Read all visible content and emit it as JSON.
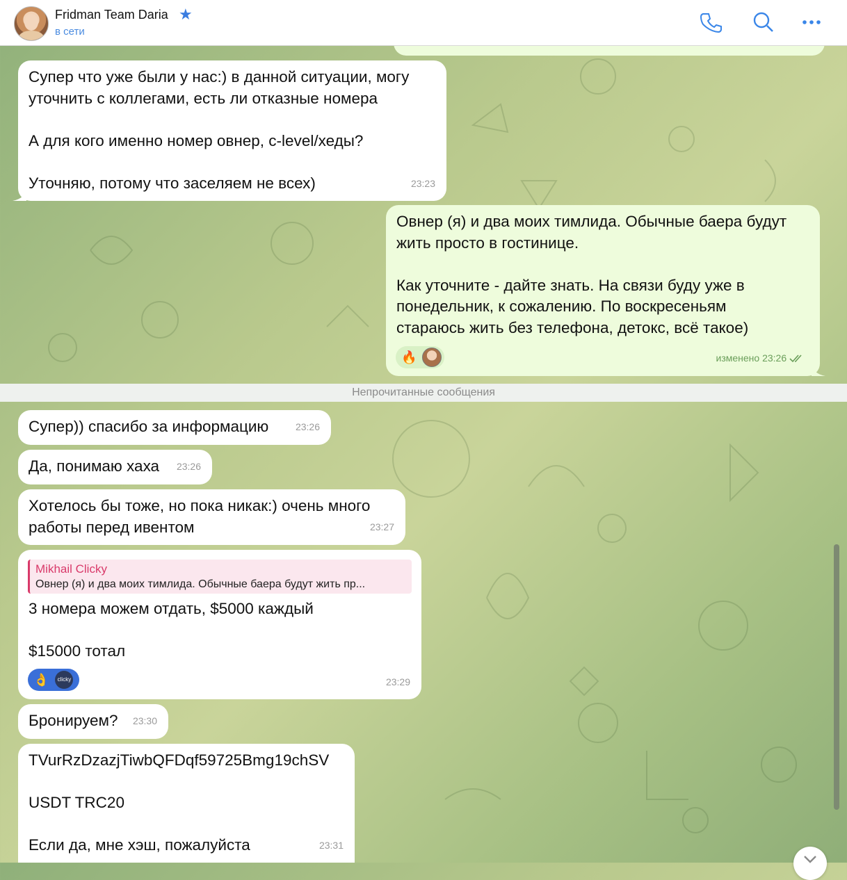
{
  "header": {
    "title": "Fridman Team Daria",
    "status": "в сети"
  },
  "messages": [
    {
      "id": "m1",
      "direction": "in",
      "text": "Супер что уже были у нас:) в данной ситуации, могу\nуточнить с коллегами, есть ли отказные номера\n\nА для кого именно номер овнер, c-level/хеды?\n\nУточняю, потому что заселяем не всех)",
      "time": "23:23"
    },
    {
      "id": "m2",
      "direction": "out",
      "text": "Овнер (я) и два моих тимлида. Обычные баера будут\nжить просто в гостинице.\n\nКак уточните - дайте знать. На связи буду уже в\nпонедельник, к сожалению. По воскресеньям\nстараюсь жить без телефона, детокс, всё такое)",
      "time": "изменено 23:26",
      "reaction": "🔥"
    },
    {
      "id": "m3",
      "direction": "in",
      "text": "Супер)) спасибо за информацию",
      "time": "23:26"
    },
    {
      "id": "m4",
      "direction": "in",
      "text": "Да, понимаю хаха",
      "time": "23:26"
    },
    {
      "id": "m5",
      "direction": "in",
      "text": "Хотелось бы тоже, но пока никак:) очень много\nработы перед ивентом",
      "time": "23:27"
    },
    {
      "id": "m6",
      "direction": "in",
      "reply_name": "Mikhail Clicky",
      "reply_text": "Овнер (я) и два моих тимлида. Обычные баера будут жить пр...",
      "text": "3 номера можем отдать, $5000 каждый\n\n$15000 тотал",
      "time": "23:29",
      "reaction": "👌",
      "reaction_avatar_label": "clicky"
    },
    {
      "id": "m7",
      "direction": "in",
      "text": "Бронируем?",
      "time": "23:30"
    },
    {
      "id": "m8",
      "direction": "in",
      "text": "TVurRzDzazjTiwbQFDqf59725Bmg19chSV\n\nUSDT TRC20\n\nЕсли да, мне хэш, пожалуйста",
      "time": "23:31"
    }
  ],
  "unread_separator": "Непрочитанные сообщения",
  "colors": {
    "accent": "#3a86e8",
    "outgoing_bubble": "#eefcdc",
    "incoming_bubble": "#ffffff",
    "reply_accent": "#d93a6a"
  },
  "icons": [
    "phone-icon",
    "search-icon",
    "more-icon",
    "star-icon",
    "read-checkmarks-icon",
    "chevron-down-icon"
  ]
}
